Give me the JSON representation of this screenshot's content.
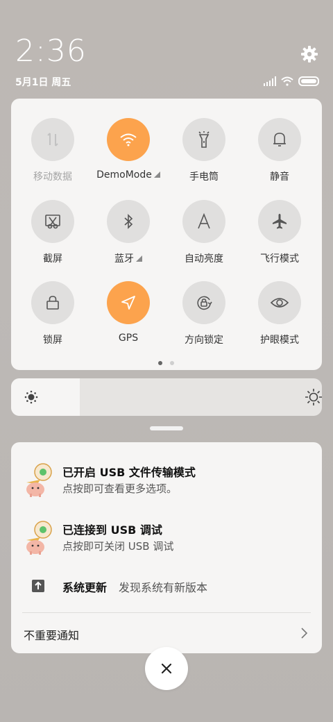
{
  "status": {
    "time": "2:36",
    "date": "5月1日 周五"
  },
  "toggles": [
    {
      "label": "移动数据",
      "icon": "mobile-data-icon",
      "active": false,
      "dim": true
    },
    {
      "label": "DemoMode",
      "icon": "wifi-icon",
      "active": true,
      "expand": true
    },
    {
      "label": "手电筒",
      "icon": "flashlight-icon",
      "active": false
    },
    {
      "label": "静音",
      "icon": "bell-icon",
      "active": false
    },
    {
      "label": "截屏",
      "icon": "screenshot-icon",
      "active": false
    },
    {
      "label": "蓝牙",
      "icon": "bluetooth-icon",
      "active": false,
      "expand": true
    },
    {
      "label": "自动亮度",
      "icon": "auto-brightness-icon",
      "active": false
    },
    {
      "label": "飞行模式",
      "icon": "airplane-icon",
      "active": false
    },
    {
      "label": "锁屏",
      "icon": "lock-icon",
      "active": false
    },
    {
      "label": "GPS",
      "icon": "location-icon",
      "active": true
    },
    {
      "label": "方向锁定",
      "icon": "rotation-lock-icon",
      "active": false
    },
    {
      "label": "护眼模式",
      "icon": "eye-icon",
      "active": false
    }
  ],
  "pager": {
    "pages": 2,
    "current": 1
  },
  "brightness": {
    "level_percent": 22
  },
  "notifications": [
    {
      "title": "已开启 USB 文件传输模式",
      "subtitle": "点按即可查看更多选项。",
      "icon": "usb-app-avatar-icon"
    },
    {
      "title": "已连接到 USB 调试",
      "subtitle": "点按即可关闭 USB 调试",
      "icon": "usb-app-avatar-icon"
    }
  ],
  "update": {
    "title": "系统更新",
    "subtitle": "发现系统有新版本",
    "icon": "system-update-icon"
  },
  "unimportant_label": "不重要通知",
  "colors": {
    "accent": "#fca34d",
    "tile_off": "#e0dfde",
    "panel": "#f6f5f4"
  }
}
